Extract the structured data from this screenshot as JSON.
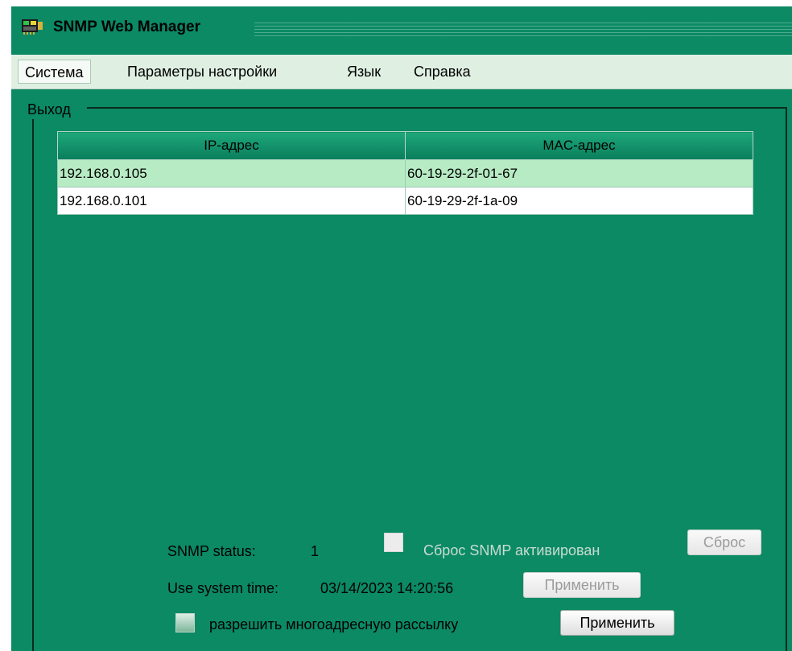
{
  "window": {
    "title": "SNMP Web Manager",
    "icon": "network-card-icon"
  },
  "menu": {
    "items": [
      "Система",
      "Параметры настройки",
      "Язык",
      "Справка"
    ],
    "active_index": 0
  },
  "group": {
    "label": "Выход"
  },
  "table": {
    "columns": [
      "IP-адрес",
      "MAC-адрес"
    ],
    "rows": [
      {
        "ip": "192.168.0.105",
        "mac": "60-19-29-2f-01-67",
        "selected": true
      },
      {
        "ip": "192.168.0.101",
        "mac": "60-19-29-2f-1a-09",
        "selected": false
      }
    ]
  },
  "snmp": {
    "status_label": "SNMP status:",
    "status_value": "1",
    "reset_checkbox_label": "Сброс SNMP активирован",
    "reset_button": "Сброс"
  },
  "system_time": {
    "label": "Use system time:",
    "value": "03/14/2023 14:20:56",
    "apply_button": "Применить"
  },
  "multicast": {
    "label": "разрешить многоадресную рассылку",
    "apply_button": "Применить"
  },
  "colors": {
    "background": "#0b8a64",
    "menubar": "#dff0e3",
    "selected_row": "#b7ebc4"
  }
}
